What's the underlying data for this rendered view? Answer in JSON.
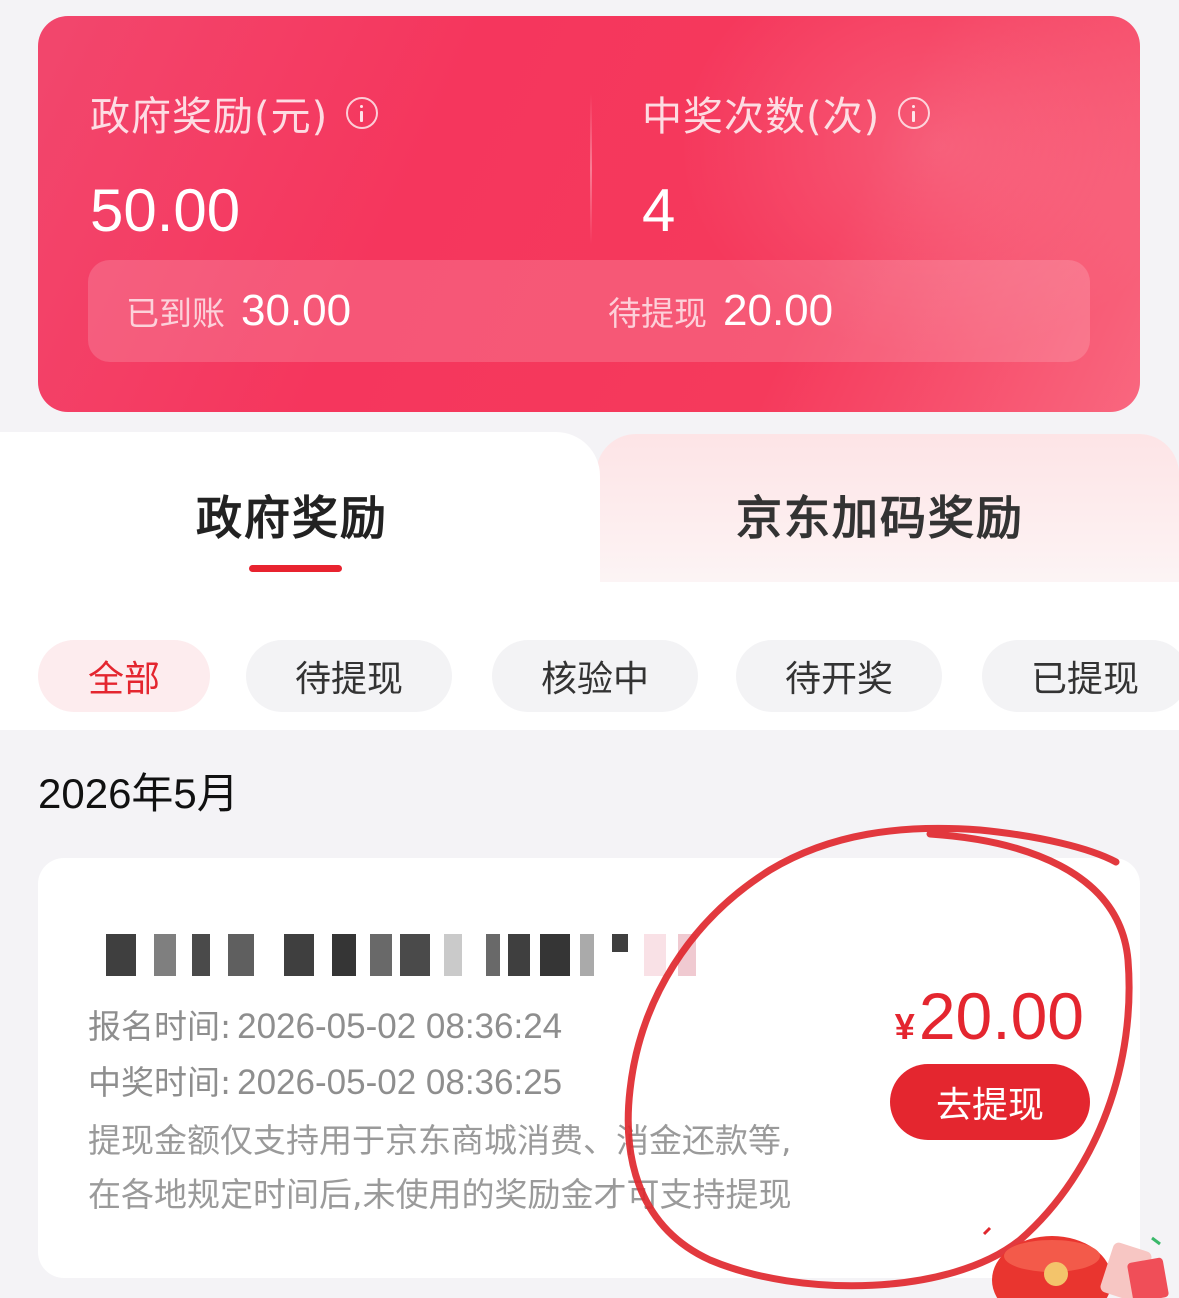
{
  "summary": {
    "gov_reward_label": "政府奖励(元)",
    "gov_reward_value": "50.00",
    "win_count_label": "中奖次数(次)",
    "win_count_value": "4",
    "arrived_label": "已到账",
    "arrived_value": "30.00",
    "pending_label": "待提现",
    "pending_value": "20.00"
  },
  "tabs": [
    {
      "label": "政府奖励",
      "active": true
    },
    {
      "label": "京东加码奖励",
      "active": false
    }
  ],
  "filters": [
    {
      "label": "全部",
      "active": true
    },
    {
      "label": "待提现",
      "active": false
    },
    {
      "label": "核验中",
      "active": false
    },
    {
      "label": "待开奖",
      "active": false
    },
    {
      "label": "已提现",
      "active": false
    }
  ],
  "month_title": "2026年5月",
  "record": {
    "signup_label": "报名时间:",
    "signup_time": "2026-05-02 08:36:24",
    "win_label": "中奖时间:",
    "win_time": "2026-05-02 08:36:25",
    "note_line1": "提现金额仅支持用于京东商城消费、消金还款等,",
    "note_line2": "在各地规定时间后,未使用的奖励金才可支持提现",
    "currency": "¥",
    "amount": "20.00",
    "withdraw_button": "去提现"
  },
  "colors": {
    "accent_red": "#e4262f",
    "card_gradient_start": "#f2476d",
    "card_gradient_end": "#f9677f",
    "annotation_red": "#e0282e"
  },
  "icons": [
    "info-icon",
    "info-icon",
    "gift-decoration-icon"
  ]
}
